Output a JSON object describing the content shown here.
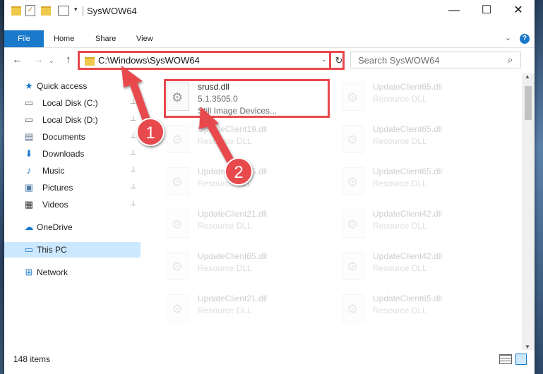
{
  "window": {
    "title": "SysWOW64",
    "minimize_glyph": "—",
    "maximize_glyph": "☐",
    "close_glyph": "✕"
  },
  "ribbon": {
    "file": "File",
    "home": "Home",
    "share": "Share",
    "view": "View",
    "help_glyph": "?",
    "collapse_glyph": "⌄"
  },
  "nav": {
    "back_glyph": "←",
    "forward_glyph": "→",
    "dropdown_glyph": "⌄",
    "up_glyph": "↑",
    "address": "C:\\Windows\\SysWOW64",
    "address_dropdown_glyph": "⌄",
    "refresh_glyph": "↻",
    "search_placeholder": "Search SysWOW64",
    "search_glyph": "⌕"
  },
  "sidebar": {
    "quick_access": "Quick access",
    "items": [
      {
        "label": "Local Disk (C:)",
        "icon": "drive-icon"
      },
      {
        "label": "Local Disk (D:)",
        "icon": "drive-icon"
      },
      {
        "label": "Documents",
        "icon": "documents-icon"
      },
      {
        "label": "Downloads",
        "icon": "downloads-icon"
      },
      {
        "label": "Music",
        "icon": "music-icon"
      },
      {
        "label": "Pictures",
        "icon": "pictures-icon"
      },
      {
        "label": "Videos",
        "icon": "videos-icon"
      }
    ],
    "onedrive": "OneDrive",
    "this_pc": "This PC",
    "network": "Network",
    "pin_glyph": "📌"
  },
  "files": {
    "selected": {
      "name": "srusd.dll",
      "version": "5.1.3505.0",
      "desc": "Still Image Devices..."
    },
    "faded": [
      {
        "name": "UpdateClient65.dll",
        "desc": "Resource DLL"
      },
      {
        "name": "UpdateClient19.dll",
        "desc": "Resource DLL"
      },
      {
        "name": "UpdateClient65.dll",
        "desc": "Resource DLL"
      },
      {
        "name": "UpdateClient65.dll",
        "desc": "Resource DLL"
      },
      {
        "name": "UpdateClient65.dll",
        "desc": "Resource DLL"
      },
      {
        "name": "UpdateClient21.dll",
        "desc": "Resource DLL"
      },
      {
        "name": "UpdateClient42.dll",
        "desc": "Resource DLL"
      },
      {
        "name": "UpdateClient65.dll",
        "desc": "Resource DLL"
      },
      {
        "name": "UpdateClient42.dll",
        "desc": "Resource DLL"
      },
      {
        "name": "UpdateClient21.dll",
        "desc": "Resource DLL"
      },
      {
        "name": "UpdateClient65.dll",
        "desc": "Resource DLL"
      }
    ]
  },
  "annotations": {
    "step1": "1",
    "step2": "2",
    "accent": "#e8484d"
  },
  "status": {
    "count": "148 items"
  }
}
